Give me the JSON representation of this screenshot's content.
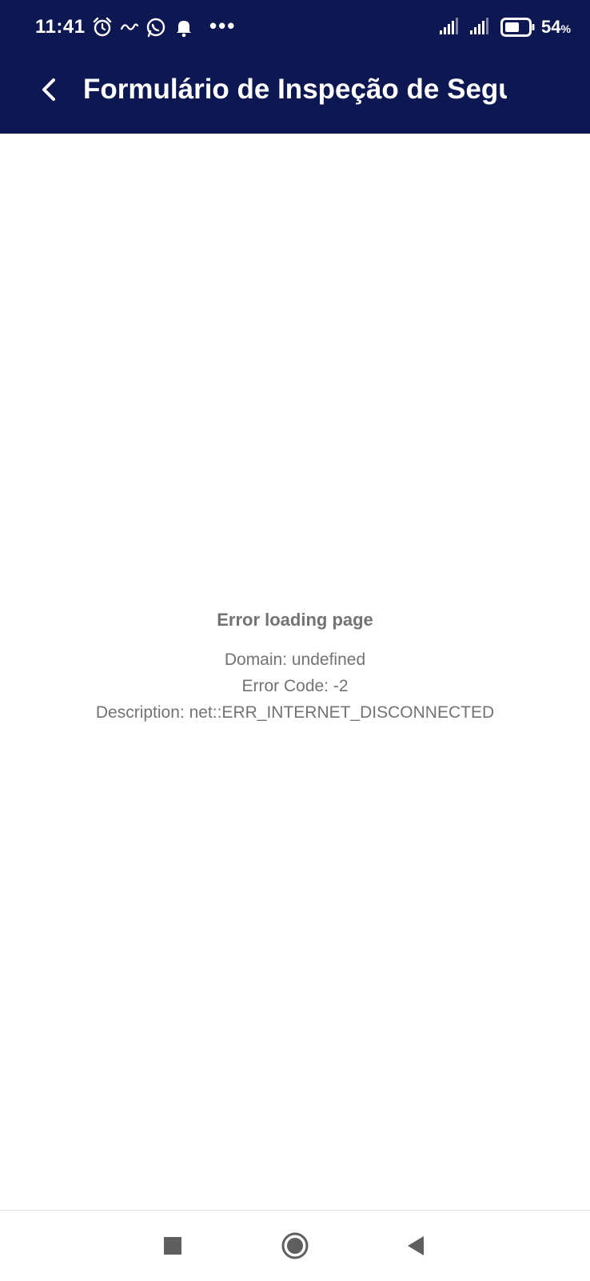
{
  "status_bar": {
    "time": "11:41",
    "icons": [
      "alarm-icon",
      "operator-logo-icon",
      "whatsapp-icon",
      "bell-icon"
    ],
    "more": "•••",
    "battery_level": "54",
    "battery_unit": "%"
  },
  "toolbar": {
    "title": "Formulário de Inspeção de Segu…",
    "back_icon": "chevron-left-icon"
  },
  "error": {
    "title": "Error loading page",
    "domain_line": "Domain: undefined",
    "code_line": "Error Code: -2",
    "description_line": "Description: net::ERR_INTERNET_DISCONNECTED"
  },
  "navigation": {
    "buttons": [
      "recents-square-icon",
      "home-circle-icon",
      "back-triangle-icon"
    ]
  },
  "colors": {
    "header_bg": "#0d1852",
    "error_text": "#737373",
    "nav_icon": "#5f5f5f"
  }
}
